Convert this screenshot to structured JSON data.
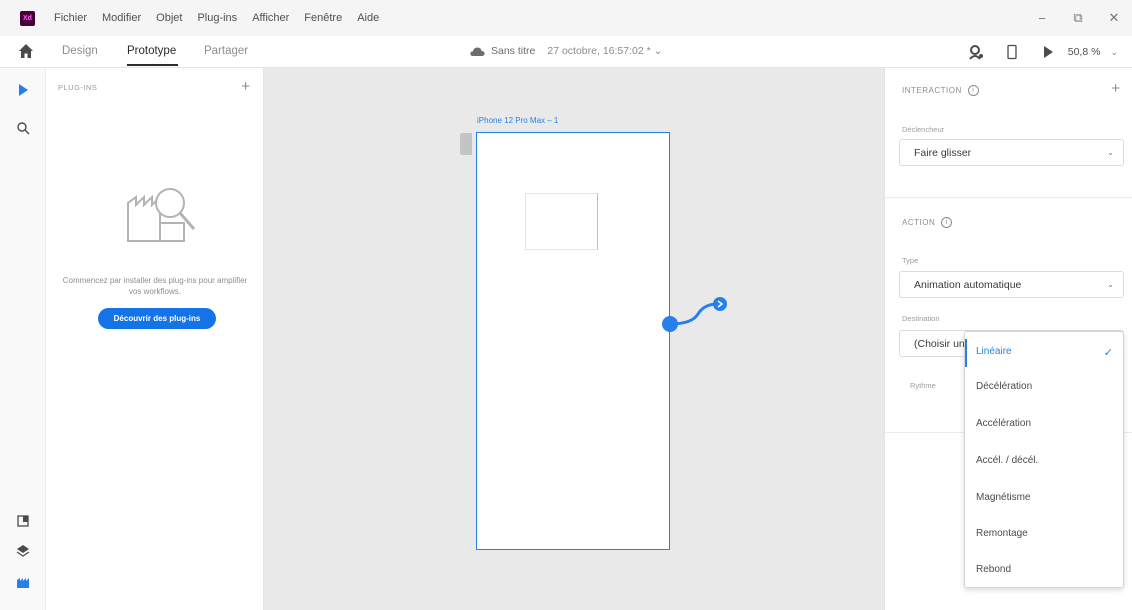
{
  "app": {
    "logo_text": "Xd"
  },
  "menubar": {
    "items": [
      "Fichier",
      "Modifier",
      "Objet",
      "Plug-ins",
      "Afficher",
      "Fenêtre",
      "Aide"
    ],
    "window_controls": {
      "minimize": "−",
      "maximize": "⧉",
      "close": "✕"
    }
  },
  "toolbar": {
    "tabs": [
      "Design",
      "Prototype",
      "Partager"
    ],
    "active_tab": "Prototype",
    "doc_name": "Sans titre",
    "doc_date": "27 octobre, 16:57:02 * ⌄",
    "zoom": "50,8 %",
    "zoom_chevron": "⌄"
  },
  "plugins": {
    "header": "PLUG-INS",
    "add": "+",
    "empty_text": "Commencez par installer des plug-ins pour amplifier vos workflows.",
    "button": "Découvrir des plug-ins"
  },
  "canvas": {
    "artboard_label": "iPhone 12 Pro Max – 1"
  },
  "inspector": {
    "interaction_title": "INTERACTION",
    "add": "+",
    "trigger_label": "Déclencheur",
    "trigger_value": "Faire glisser",
    "action_title": "ACTION",
    "type_label": "Type",
    "type_value": "Animation automatique",
    "destination_label": "Destination",
    "destination_value": "(Choisir un",
    "easing_label": "Rythme",
    "info": "i",
    "chevron": "⌄"
  },
  "easing_menu": {
    "items": [
      "Linéaire",
      "Décélération",
      "Accélération",
      "Accél. / décél.",
      "Magnétisme",
      "Remontage",
      "Rebond"
    ],
    "selected_index": 0,
    "check": "✓"
  },
  "colors": {
    "accent": "#2680eb",
    "button_blue": "#1473e6",
    "canvas_bg": "#e9e9e9",
    "xd_logo_bg": "#470137",
    "xd_logo_fg": "#ff61f6"
  }
}
